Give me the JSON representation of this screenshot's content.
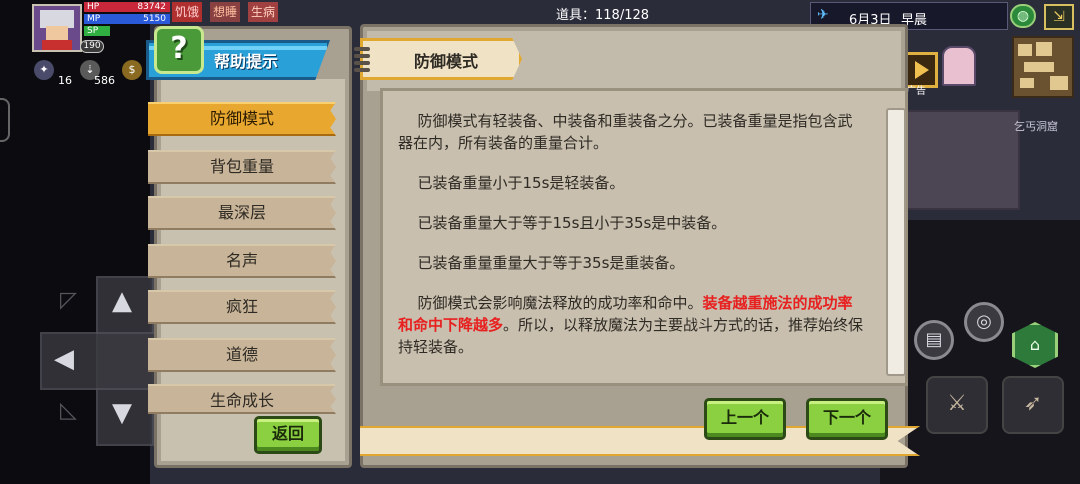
{
  "hud": {
    "hp_label": "HP",
    "hp_value": "83742",
    "mp_label": "MP",
    "mp_value": "5150",
    "sp_label": "SP",
    "level": "190",
    "status_hunger": "饥饿",
    "status_sleepy": "想睡",
    "status_sick": "生病",
    "stat1": "16",
    "stat2": "586",
    "items_label": "道具：118/128",
    "date": "6月3日",
    "time_of_day": "早晨",
    "ad_label": "广告",
    "location": "乞丐洞窟"
  },
  "help": {
    "header": "帮助提示",
    "topics": [
      {
        "label": "防御模式",
        "active": true
      },
      {
        "label": "背包重量",
        "active": false
      },
      {
        "label": "最深层",
        "active": false
      },
      {
        "label": "名声",
        "active": false
      },
      {
        "label": "疯狂",
        "active": false
      },
      {
        "label": "道德",
        "active": false
      },
      {
        "label": "生命成长",
        "active": false
      }
    ],
    "back_button": "返回"
  },
  "content": {
    "title": "防御模式",
    "p1": "防御模式有轻装备、中装备和重装备之分。已装备重量是指包含武器在内，所有装备的重量合计。",
    "p2": "已装备重量小于15s是轻装备。",
    "p3": "已装备重量大于等于15s且小于35s是中装备。",
    "p4": "已装备重量重量大于等于35s是重装备。",
    "p5_a": "防御模式会影响魔法释放的成功率和命中。",
    "p5_red": "装备越重施法的成功率和命中下降越多",
    "p5_b": "。所以，以释放魔法为主要战斗方式的话，推荐始终保持轻装备。",
    "prev_button": "上一个",
    "next_button": "下一个"
  },
  "icons": {
    "help": "question-mark-icon",
    "close": "close-x-icon",
    "globe": "globe-icon",
    "exit": "exit-icon",
    "plane": "plane-icon",
    "ad_play": "play-icon"
  },
  "colors": {
    "active_topic": "#e8a830",
    "header_blue": "#2aa0d8",
    "button_green": "#8ad040",
    "emphasis_red": "#e82020"
  }
}
